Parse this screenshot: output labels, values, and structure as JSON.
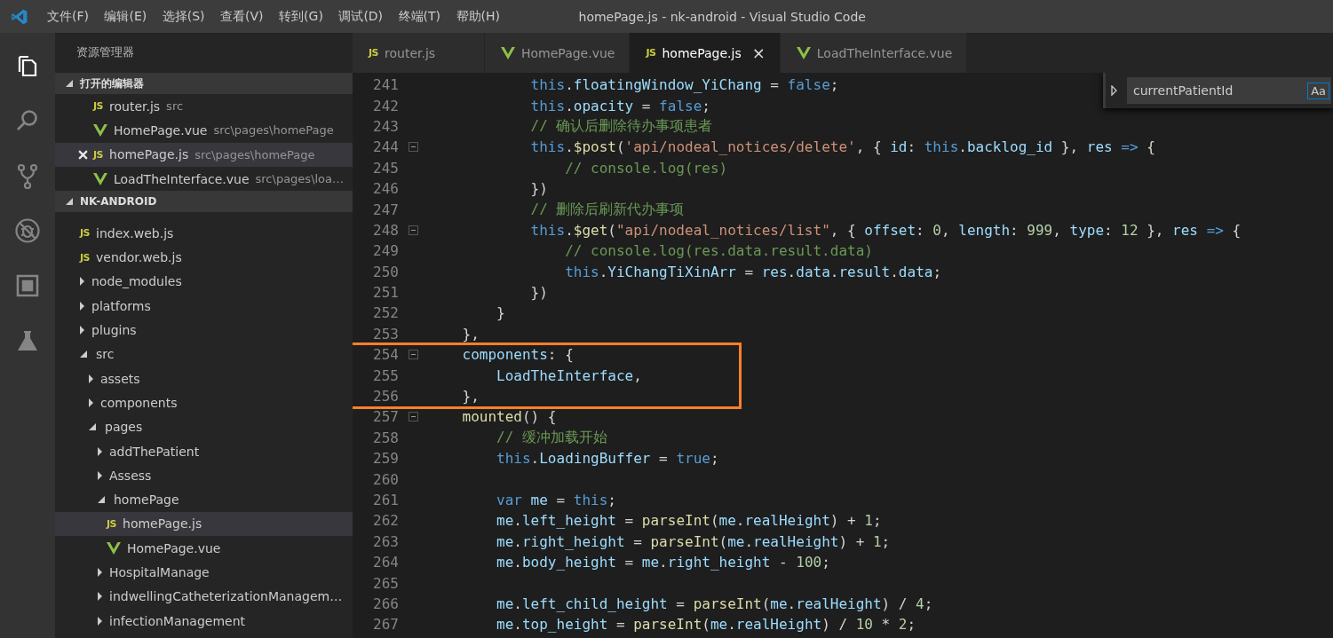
{
  "window": {
    "title": "homePage.js - nk-android - Visual Studio Code"
  },
  "menu": [
    "文件(F)",
    "编辑(E)",
    "选择(S)",
    "查看(V)",
    "转到(G)",
    "调试(D)",
    "终端(T)",
    "帮助(H)"
  ],
  "activity_bar": [
    {
      "kind": "explorer",
      "selected": true
    },
    {
      "kind": "search",
      "selected": false
    },
    {
      "kind": "scm",
      "selected": false
    },
    {
      "kind": "debug",
      "selected": false
    },
    {
      "kind": "extensions",
      "selected": false
    },
    {
      "kind": "test",
      "selected": false
    }
  ],
  "sidebar": {
    "title": "资源管理器",
    "open_editors": {
      "title": "打开的编辑器",
      "expanded": true,
      "items": [
        {
          "name": "router.js",
          "path": "src",
          "kind": "js",
          "icon": "JS",
          "selected": false
        },
        {
          "name": "HomePage.vue",
          "path": "src\\pages\\homePage",
          "kind": "vue",
          "selected": false
        },
        {
          "name": "homePage.js",
          "path": "src\\pages\\homePage",
          "kind": "js",
          "icon": "JS",
          "selected": true
        },
        {
          "name": "LoadTheInterface.vue",
          "path": "src\\pages\\loa…",
          "kind": "vue",
          "selected": false
        }
      ]
    },
    "project": {
      "title": "NK-ANDROID",
      "expanded": true,
      "items": [
        {
          "name": "index.web.js",
          "kind": "js",
          "icon": "JS",
          "selected": false
        },
        {
          "name": "vendor.web.js",
          "kind": "js",
          "icon": "JS",
          "selected": false
        },
        {
          "name": "node_modules",
          "kind": "folder",
          "expanded": false,
          "selected": false
        },
        {
          "name": "platforms",
          "kind": "folder",
          "expanded": false,
          "selected": false
        },
        {
          "name": "plugins",
          "kind": "folder",
          "expanded": false,
          "selected": false
        },
        {
          "name": "src",
          "kind": "folder",
          "expanded": true,
          "selected": false,
          "children": [
            {
              "name": "assets",
              "kind": "folder",
              "expanded": false,
              "selected": false
            },
            {
              "name": "components",
              "kind": "folder",
              "expanded": false,
              "selected": false
            },
            {
              "name": "pages",
              "kind": "folder",
              "expanded": true,
              "selected": false,
              "children": [
                {
                  "name": "addThePatient",
                  "kind": "folder",
                  "expanded": false,
                  "selected": false
                },
                {
                  "name": "Assess",
                  "kind": "folder",
                  "expanded": false,
                  "selected": false
                },
                {
                  "name": "homePage",
                  "kind": "folder",
                  "expanded": true,
                  "selected": false,
                  "children": [
                    {
                      "name": "homePage.js",
                      "kind": "js",
                      "icon": "JS",
                      "selected": true
                    },
                    {
                      "name": "HomePage.vue",
                      "kind": "vue",
                      "selected": false
                    }
                  ]
                },
                {
                  "name": "HospitalManage",
                  "kind": "folder",
                  "expanded": false,
                  "selected": false
                },
                {
                  "name": "indwellingCatheterizationManagem…",
                  "kind": "folder",
                  "expanded": false,
                  "selected": false
                },
                {
                  "name": "infectionManagement",
                  "kind": "folder",
                  "expanded": false,
                  "selected": false
                }
              ]
            }
          ]
        }
      ]
    }
  },
  "tabs": [
    {
      "label": "router.js",
      "kind": "js",
      "icon": "JS",
      "selected": false
    },
    {
      "label": "HomePage.vue",
      "kind": "vue",
      "selected": false
    },
    {
      "label": "homePage.js",
      "kind": "js",
      "icon": "JS",
      "selected": true,
      "close": "×"
    },
    {
      "label": "LoadTheInterface.vue",
      "kind": "vue",
      "selected": false
    }
  ],
  "find_widget": {
    "value": "currentPatientId",
    "match_case": {
      "label": "Aa",
      "on": true
    }
  },
  "editor": {
    "lines": [
      {
        "number": "241",
        "fold": false,
        "highlighted": false,
        "tokens": [
          {
            "kind": "k",
            "text": "            this"
          },
          {
            "kind": "p",
            "text": "."
          },
          {
            "kind": "v",
            "text": "floatingWindow_YiChang"
          },
          {
            "kind": "p",
            "text": " = "
          },
          {
            "kind": "k",
            "text": "false"
          },
          {
            "kind": "p",
            "text": ";"
          }
        ]
      },
      {
        "number": "242",
        "fold": false,
        "highlighted": false,
        "tokens": [
          {
            "kind": "k",
            "text": "            this"
          },
          {
            "kind": "p",
            "text": "."
          },
          {
            "kind": "v",
            "text": "opacity"
          },
          {
            "kind": "p",
            "text": " = "
          },
          {
            "kind": "k",
            "text": "false"
          },
          {
            "kind": "p",
            "text": ";"
          }
        ]
      },
      {
        "number": "243",
        "fold": false,
        "highlighted": false,
        "tokens": [
          {
            "kind": "c",
            "text": "            // 确认后删除待办事项患者"
          }
        ]
      },
      {
        "number": "244",
        "fold": true,
        "highlighted": false,
        "tokens": [
          {
            "kind": "k",
            "text": "            this"
          },
          {
            "kind": "p",
            "text": "."
          },
          {
            "kind": "f",
            "text": "$post"
          },
          {
            "kind": "p",
            "text": "("
          },
          {
            "kind": "s",
            "text": "'api/nodeal_notices/delete'"
          },
          {
            "kind": "p",
            "text": ", { "
          },
          {
            "kind": "v",
            "text": "id"
          },
          {
            "kind": "p",
            "text": ": "
          },
          {
            "kind": "k",
            "text": "this"
          },
          {
            "kind": "p",
            "text": "."
          },
          {
            "kind": "v",
            "text": "backlog_id"
          },
          {
            "kind": "p",
            "text": " }, "
          },
          {
            "kind": "v",
            "text": "res"
          },
          {
            "kind": "k",
            "text": " =>"
          },
          {
            "kind": "p",
            "text": " {"
          }
        ]
      },
      {
        "number": "245",
        "fold": false,
        "highlighted": false,
        "tokens": [
          {
            "kind": "c",
            "text": "                // console.log(res)"
          }
        ]
      },
      {
        "number": "246",
        "fold": false,
        "highlighted": false,
        "tokens": [
          {
            "kind": "p",
            "text": "            })"
          }
        ]
      },
      {
        "number": "247",
        "fold": false,
        "highlighted": false,
        "tokens": [
          {
            "kind": "c",
            "text": "            // 删除后刷新代办事项"
          }
        ]
      },
      {
        "number": "248",
        "fold": true,
        "highlighted": false,
        "tokens": [
          {
            "kind": "k",
            "text": "            this"
          },
          {
            "kind": "p",
            "text": "."
          },
          {
            "kind": "f",
            "text": "$get"
          },
          {
            "kind": "p",
            "text": "("
          },
          {
            "kind": "s",
            "text": "\"api/nodeal_notices/list\""
          },
          {
            "kind": "p",
            "text": ", { "
          },
          {
            "kind": "v",
            "text": "offset"
          },
          {
            "kind": "p",
            "text": ": "
          },
          {
            "kind": "n",
            "text": "0"
          },
          {
            "kind": "p",
            "text": ", "
          },
          {
            "kind": "v",
            "text": "length"
          },
          {
            "kind": "p",
            "text": ": "
          },
          {
            "kind": "n",
            "text": "999"
          },
          {
            "kind": "p",
            "text": ", "
          },
          {
            "kind": "v",
            "text": "type"
          },
          {
            "kind": "p",
            "text": ": "
          },
          {
            "kind": "n",
            "text": "12"
          },
          {
            "kind": "p",
            "text": " }, "
          },
          {
            "kind": "v",
            "text": "res"
          },
          {
            "kind": "k",
            "text": " =>"
          },
          {
            "kind": "p",
            "text": " {"
          }
        ]
      },
      {
        "number": "249",
        "fold": false,
        "highlighted": false,
        "tokens": [
          {
            "kind": "c",
            "text": "                // console.log(res.data.result.data)"
          }
        ]
      },
      {
        "number": "250",
        "fold": false,
        "highlighted": false,
        "tokens": [
          {
            "kind": "k",
            "text": "                this"
          },
          {
            "kind": "p",
            "text": "."
          },
          {
            "kind": "v",
            "text": "YiChangTiXinArr"
          },
          {
            "kind": "p",
            "text": " = "
          },
          {
            "kind": "v",
            "text": "res"
          },
          {
            "kind": "p",
            "text": "."
          },
          {
            "kind": "v",
            "text": "data"
          },
          {
            "kind": "p",
            "text": "."
          },
          {
            "kind": "v",
            "text": "result"
          },
          {
            "kind": "p",
            "text": "."
          },
          {
            "kind": "v",
            "text": "data"
          },
          {
            "kind": "p",
            "text": ";"
          }
        ]
      },
      {
        "number": "251",
        "fold": false,
        "highlighted": false,
        "tokens": [
          {
            "kind": "p",
            "text": "            })"
          }
        ]
      },
      {
        "number": "252",
        "fold": false,
        "highlighted": false,
        "tokens": [
          {
            "kind": "p",
            "text": "        }"
          }
        ]
      },
      {
        "number": "253",
        "fold": false,
        "highlighted": false,
        "tokens": [
          {
            "kind": "p",
            "text": "    },"
          }
        ]
      },
      {
        "number": "254",
        "fold": true,
        "highlighted": true,
        "tokens": [
          {
            "kind": "v",
            "text": "    components"
          },
          {
            "kind": "p",
            "text": ": {"
          }
        ]
      },
      {
        "number": "255",
        "fold": false,
        "highlighted": true,
        "tokens": [
          {
            "kind": "v",
            "text": "        LoadTheInterface"
          },
          {
            "kind": "p",
            "text": ","
          }
        ]
      },
      {
        "number": "256",
        "fold": false,
        "highlighted": true,
        "tokens": [
          {
            "kind": "p",
            "text": "    },"
          }
        ]
      },
      {
        "number": "257",
        "fold": true,
        "highlighted": false,
        "tokens": [
          {
            "kind": "f",
            "text": "    mounted"
          },
          {
            "kind": "p",
            "text": "() {"
          }
        ]
      },
      {
        "number": "258",
        "fold": false,
        "highlighted": false,
        "tokens": [
          {
            "kind": "c",
            "text": "        // 缓冲加载开始"
          }
        ]
      },
      {
        "number": "259",
        "fold": false,
        "highlighted": false,
        "tokens": [
          {
            "kind": "k",
            "text": "        this"
          },
          {
            "kind": "p",
            "text": "."
          },
          {
            "kind": "v",
            "text": "LoadingBuffer"
          },
          {
            "kind": "p",
            "text": " = "
          },
          {
            "kind": "k",
            "text": "true"
          },
          {
            "kind": "p",
            "text": ";"
          }
        ]
      },
      {
        "number": "260",
        "fold": false,
        "highlighted": false
      },
      {
        "number": "261",
        "fold": false,
        "highlighted": false,
        "tokens": [
          {
            "kind": "k",
            "text": "        var"
          },
          {
            "kind": "v",
            "text": " me"
          },
          {
            "kind": "p",
            "text": " = "
          },
          {
            "kind": "k",
            "text": "this"
          },
          {
            "kind": "p",
            "text": ";"
          }
        ]
      },
      {
        "number": "262",
        "fold": false,
        "highlighted": false,
        "tokens": [
          {
            "kind": "v",
            "text": "        me"
          },
          {
            "kind": "p",
            "text": "."
          },
          {
            "kind": "v",
            "text": "left_height"
          },
          {
            "kind": "p",
            "text": " = "
          },
          {
            "kind": "f",
            "text": "parseInt"
          },
          {
            "kind": "p",
            "text": "("
          },
          {
            "kind": "v",
            "text": "me"
          },
          {
            "kind": "p",
            "text": "."
          },
          {
            "kind": "v",
            "text": "realHeight"
          },
          {
            "kind": "p",
            "text": ") + "
          },
          {
            "kind": "n",
            "text": "1"
          },
          {
            "kind": "p",
            "text": ";"
          }
        ]
      },
      {
        "number": "263",
        "fold": false,
        "highlighted": false,
        "tokens": [
          {
            "kind": "v",
            "text": "        me"
          },
          {
            "kind": "p",
            "text": "."
          },
          {
            "kind": "v",
            "text": "right_height"
          },
          {
            "kind": "p",
            "text": " = "
          },
          {
            "kind": "f",
            "text": "parseInt"
          },
          {
            "kind": "p",
            "text": "("
          },
          {
            "kind": "v",
            "text": "me"
          },
          {
            "kind": "p",
            "text": "."
          },
          {
            "kind": "v",
            "text": "realHeight"
          },
          {
            "kind": "p",
            "text": ") + "
          },
          {
            "kind": "n",
            "text": "1"
          },
          {
            "kind": "p",
            "text": ";"
          }
        ]
      },
      {
        "number": "264",
        "fold": false,
        "highlighted": false,
        "tokens": [
          {
            "kind": "v",
            "text": "        me"
          },
          {
            "kind": "p",
            "text": "."
          },
          {
            "kind": "v",
            "text": "body_height"
          },
          {
            "kind": "p",
            "text": " = "
          },
          {
            "kind": "v",
            "text": "me"
          },
          {
            "kind": "p",
            "text": "."
          },
          {
            "kind": "v",
            "text": "right_height"
          },
          {
            "kind": "p",
            "text": " - "
          },
          {
            "kind": "n",
            "text": "100"
          },
          {
            "kind": "p",
            "text": ";"
          }
        ]
      },
      {
        "number": "265",
        "fold": false,
        "highlighted": false
      },
      {
        "number": "266",
        "fold": false,
        "highlighted": false,
        "tokens": [
          {
            "kind": "v",
            "text": "        me"
          },
          {
            "kind": "p",
            "text": "."
          },
          {
            "kind": "v",
            "text": "left_child_height"
          },
          {
            "kind": "p",
            "text": " = "
          },
          {
            "kind": "f",
            "text": "parseInt"
          },
          {
            "kind": "p",
            "text": "("
          },
          {
            "kind": "v",
            "text": "me"
          },
          {
            "kind": "p",
            "text": "."
          },
          {
            "kind": "v",
            "text": "realHeight"
          },
          {
            "kind": "p",
            "text": ") / "
          },
          {
            "kind": "n",
            "text": "4"
          },
          {
            "kind": "p",
            "text": ";"
          }
        ]
      },
      {
        "number": "267",
        "fold": false,
        "highlighted": false,
        "tokens": [
          {
            "kind": "v",
            "text": "        me"
          },
          {
            "kind": "p",
            "text": "."
          },
          {
            "kind": "v",
            "text": "top_height"
          },
          {
            "kind": "p",
            "text": " = "
          },
          {
            "kind": "f",
            "text": "parseInt"
          },
          {
            "kind": "p",
            "text": "("
          },
          {
            "kind": "v",
            "text": "me"
          },
          {
            "kind": "p",
            "text": "."
          },
          {
            "kind": "v",
            "text": "realHeight"
          },
          {
            "kind": "p",
            "text": ") / "
          },
          {
            "kind": "n",
            "text": "10"
          },
          {
            "kind": "p",
            "text": " * "
          },
          {
            "kind": "n",
            "text": "2"
          },
          {
            "kind": "p",
            "text": ";"
          }
        ]
      }
    ]
  }
}
